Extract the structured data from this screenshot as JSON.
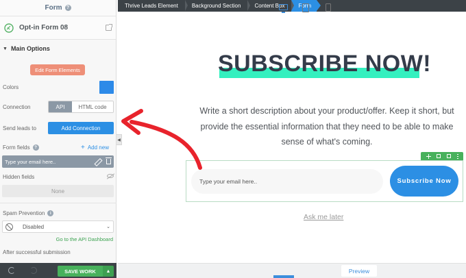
{
  "sidebar": {
    "header_title": "Form",
    "element_name": "Opt-in Form 08",
    "main_options": "Main Options",
    "edit_form_elements": "Edit Form Elements",
    "colors_label": "Colors",
    "color_value": "#2d8ae8",
    "connection_label": "Connection",
    "connection_api": "API",
    "connection_html": "HTML code",
    "send_leads_label": "Send leads to",
    "add_connection": "Add Connection",
    "form_fields_label": "Form fields",
    "add_new": "Add new",
    "field_item": "Type your email here..",
    "hidden_fields_label": "Hidden fields",
    "hidden_none": "None",
    "spam_label": "Spam Prevention",
    "spam_value": "Disabled",
    "api_dashboard_link": "Go to the API Dashboard",
    "after_submission_label": "After successful submission",
    "save_work": "SAVE WORK"
  },
  "breadcrumb": [
    "Thrive Leads Element",
    "Background Section",
    "Content Box",
    "Form"
  ],
  "canvas": {
    "headline": "SUBSCRIBE NOW!",
    "description": "Write a short description about your product/offer. Keep it short, but provide the essential information that they need to be able to make sense of what's coming.",
    "email_placeholder": "Type your email here..",
    "subscribe_button": "Subscribe Now",
    "ask_later": "Ask me later"
  },
  "device_bar": {
    "preview": "Preview",
    "active_device": "desktop"
  },
  "colors": {
    "accent_blue": "#2c8fe4",
    "highlight_teal": "#34f0bf",
    "save_green": "#48b15c",
    "arrow_red": "#e8232c"
  }
}
